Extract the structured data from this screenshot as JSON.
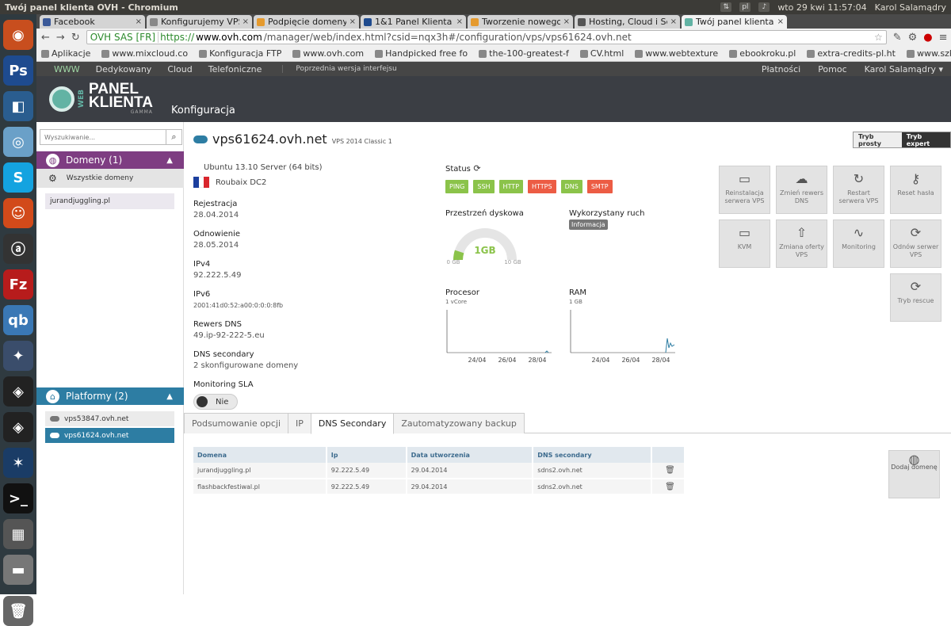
{
  "system": {
    "window_title": "Twój panel klienta OVH - Chromium",
    "datetime": "wto 29 kwi 11:57:04",
    "user": "Karol Salamądry",
    "tray_label": "pl"
  },
  "browser": {
    "tabs": [
      {
        "label": "Facebook",
        "icon_color": "#3b5998"
      },
      {
        "label": "Konfigurujemy VPS - c",
        "icon_color": "#888888"
      },
      {
        "label": "Podpięcie domeny do",
        "icon_color": "#e59a2e"
      },
      {
        "label": "1&1 Panel Klienta",
        "icon_color": "#1f4b8e"
      },
      {
        "label": "Tworzenie nowego te",
        "icon_color": "#e59a2e"
      },
      {
        "label": "Hosting, Cloud i Serwe",
        "icon_color": "#555555"
      },
      {
        "label": "Twój panel klienta OV",
        "icon_color": "#62b3a4"
      }
    ],
    "ev_label": "OVH SAS [FR]",
    "url_scheme": "https://",
    "url_host": "www.ovh.com",
    "url_path": "/manager/web/index.html?csid=nqx3h#/configuration/vps/vps61624.ovh.net",
    "bookmarks": [
      "Aplikacje",
      "www.mixcloud.co",
      "Konfiguracja FTP",
      "www.ovh.com",
      "Handpicked free fo",
      "the-100-greatest-f",
      "CV.html",
      "www.webtexture",
      "ebookroku.pl",
      "extra-credits-pl.ht",
      "www.szkolyzaoczr"
    ]
  },
  "ovh_nav": {
    "left": [
      "WWW",
      "Dedykowany",
      "Cloud",
      "Telefoniczne"
    ],
    "prev_version": "Poprzednia wersja interfejsu",
    "right": [
      "Płatności",
      "Pomoc",
      "Karol Salamądry ▾"
    ]
  },
  "header": {
    "logo_web": "WEB",
    "logo_line1": "PANEL",
    "logo_line2": "KLIENTA",
    "logo_sub": "GAMMA",
    "page_title": "Konfiguracja"
  },
  "sidebar": {
    "search_placeholder": "Wyszukiwanie...",
    "domains_header": "Domeny (1)",
    "all_domains": "Wszystkie domeny",
    "domain_item": "jurandjuggling.pl",
    "platforms_header": "Platformy (2)",
    "vps_items": [
      "vps53847.ovh.net",
      "vps61624.ovh.net"
    ]
  },
  "vps": {
    "name": "vps61624.ovh.net",
    "plan": "VPS 2014 Classic 1",
    "mode_simple": "Tryb prosty",
    "mode_expert": "Tryb expert",
    "os": "Ubuntu 13.10 Server (64 bits)",
    "datacenter": "Roubaix DC2",
    "registration_label": "Rejestracja",
    "registration": "28.04.2014",
    "renewal_label": "Odnowienie",
    "renewal": "28.05.2014",
    "ipv4_label": "IPv4",
    "ipv4": "92.222.5.49",
    "ipv6_label": "IPv6",
    "ipv6": "2001:41d0:52:a00:0:0:0:8fb",
    "reverse_label": "Rewers DNS",
    "reverse": "49.ip-92-222-5.eu",
    "dns_secondary_label": "DNS secondary",
    "dns_secondary": "2 skonfigurowane domeny",
    "sla_label": "Monitoring SLA",
    "sla_value": "Nie"
  },
  "status": {
    "label": "Status",
    "pills": [
      {
        "label": "PING",
        "ok": true
      },
      {
        "label": "SSH",
        "ok": true
      },
      {
        "label": "HTTP",
        "ok": true
      },
      {
        "label": "HTTPS",
        "ok": false
      },
      {
        "label": "DNS",
        "ok": true
      },
      {
        "label": "SMTP",
        "ok": false
      }
    ]
  },
  "disk": {
    "label": "Przestrzeń dyskowa",
    "value_label": "1GB",
    "min": "0 GB",
    "max": "10 GB",
    "used_fraction": 0.1
  },
  "traffic": {
    "label": "Wykorzystany ruch",
    "badge": "Informacja"
  },
  "cpu": {
    "label": "Procesor",
    "sub": "1 vCore",
    "ticks": [
      "24/04",
      "26/04",
      "28/04"
    ]
  },
  "ram": {
    "label": "RAM",
    "sub": "1 GB",
    "ticks": [
      "24/04",
      "26/04",
      "28/04"
    ]
  },
  "actions": [
    {
      "label": "Reinstalacja serwera VPS",
      "icon": "server-reinstall-icon",
      "glyph": "▭"
    },
    {
      "label": "Zmień rewers DNS",
      "icon": "dns-icon",
      "glyph": "☁"
    },
    {
      "label": "Restart serwera VPS",
      "icon": "restart-icon",
      "glyph": "↻"
    },
    {
      "label": "Reset hasła",
      "icon": "key-icon",
      "glyph": "⚷"
    },
    {
      "label": "KVM",
      "icon": "terminal-icon",
      "glyph": "▭"
    },
    {
      "label": "Zmiana oferty VPS",
      "icon": "upgrade-icon",
      "glyph": "⇧"
    },
    {
      "label": "Monitoring",
      "icon": "monitoring-icon",
      "glyph": "∿"
    },
    {
      "label": "Odnów serwer VPS",
      "icon": "renew-icon",
      "glyph": "⟳"
    },
    {
      "label": "Tryb rescue",
      "icon": "rescue-icon",
      "glyph": "⟳"
    }
  ],
  "bottom_tabs": [
    "Podsumowanie opcji",
    "IP",
    "DNS Secondary",
    "Zautomatyzowany backup"
  ],
  "dns_table": {
    "headers": [
      "Domena",
      "Ip",
      "Data utworzenia",
      "DNS secondary",
      ""
    ],
    "rows": [
      [
        "jurandjuggling.pl",
        "92.222.5.49",
        "29.04.2014",
        "sdns2.ovh.net"
      ],
      [
        "flashbackfestiwal.pl",
        "92.222.5.49",
        "29.04.2014",
        "sdns2.ovh.net"
      ]
    ]
  },
  "add_domain": "Dodaj domenę",
  "colors": {
    "purple": "#7e3d82",
    "blue": "#2d7da3",
    "green": "#8bc34a",
    "red": "#ec5c44"
  }
}
